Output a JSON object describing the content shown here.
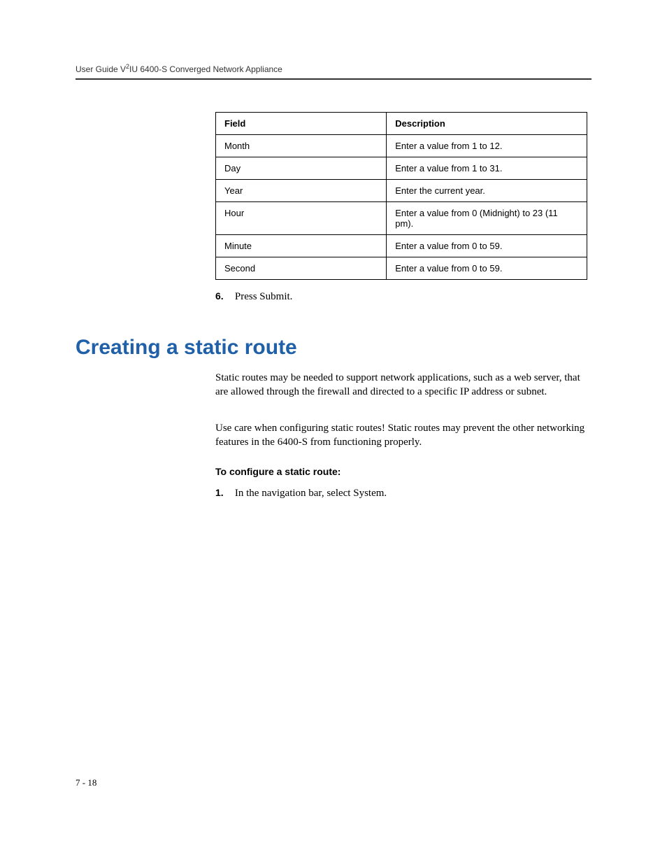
{
  "header": {
    "prefix": "User Guide V",
    "sup": "2",
    "suffix": "IU 6400-S Converged Network Appliance"
  },
  "table": {
    "headers": {
      "field": "Field",
      "description": "Description"
    },
    "rows": [
      {
        "field": "Month",
        "description": "Enter a value from 1 to 12."
      },
      {
        "field": "Day",
        "description": "Enter a value from 1 to 31."
      },
      {
        "field": "Year",
        "description": "Enter the current year."
      },
      {
        "field": "Hour",
        "description": "Enter a value from 0 (Midnight) to 23 (11 pm)."
      },
      {
        "field": "Minute",
        "description": "Enter a value from 0 to 59."
      },
      {
        "field": "Second",
        "description": "Enter a value from 0 to 59."
      }
    ]
  },
  "step6": {
    "number": "6.",
    "text": "Press Submit."
  },
  "section": {
    "heading": "Creating a static route",
    "para1": "Static routes may be needed to support network applications, such as a web server, that are allowed through the firewall and directed to a specific IP address or subnet.",
    "para2": "Use care when configuring static routes! Static routes may prevent the other networking features in the 6400-S from functioning properly.",
    "subheading": "To configure a static route:",
    "step1": {
      "number": "1.",
      "text": "In the navigation bar, select System."
    }
  },
  "pageNumber": "7 - 18"
}
